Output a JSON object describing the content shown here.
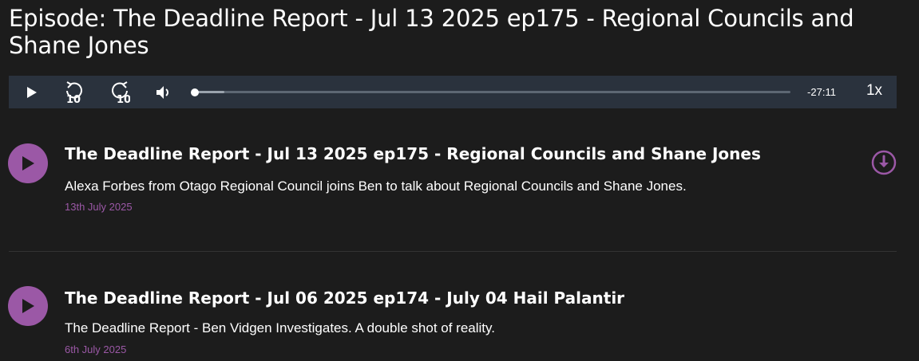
{
  "page": {
    "title": "Episode: The Deadline Report - Jul 13 2025 ep175 - Regional Councils and Shane Jones"
  },
  "player": {
    "icons": {
      "play": "play-icon",
      "rewind": "rewind-10-icon",
      "forward": "forward-10-icon",
      "volume": "volume-icon"
    },
    "progress_fraction": 0.0,
    "buffered_fraction": 0.05,
    "time_remaining": "-27:11",
    "speed": "1x"
  },
  "episodes": [
    {
      "title": "The Deadline Report - Jul 13 2025 ep175 - Regional Councils and Shane Jones",
      "description": "Alexa Forbes from Otago Regional Council joins Ben to talk about Regional Councils and Shane Jones.",
      "date": "13th July 2025",
      "has_download": true
    },
    {
      "title": "The Deadline Report - Jul 06 2025 ep174 - July 04 Hail Palantir",
      "description": "The Deadline Report - Ben Vidgen Investigates. A double shot of reality.",
      "date": "6th July 2025",
      "has_download": false
    }
  ],
  "colors": {
    "background": "#1c1c1c",
    "player_bar": "#2a323d",
    "accent": "#9b58a6",
    "text": "#ffffff"
  }
}
